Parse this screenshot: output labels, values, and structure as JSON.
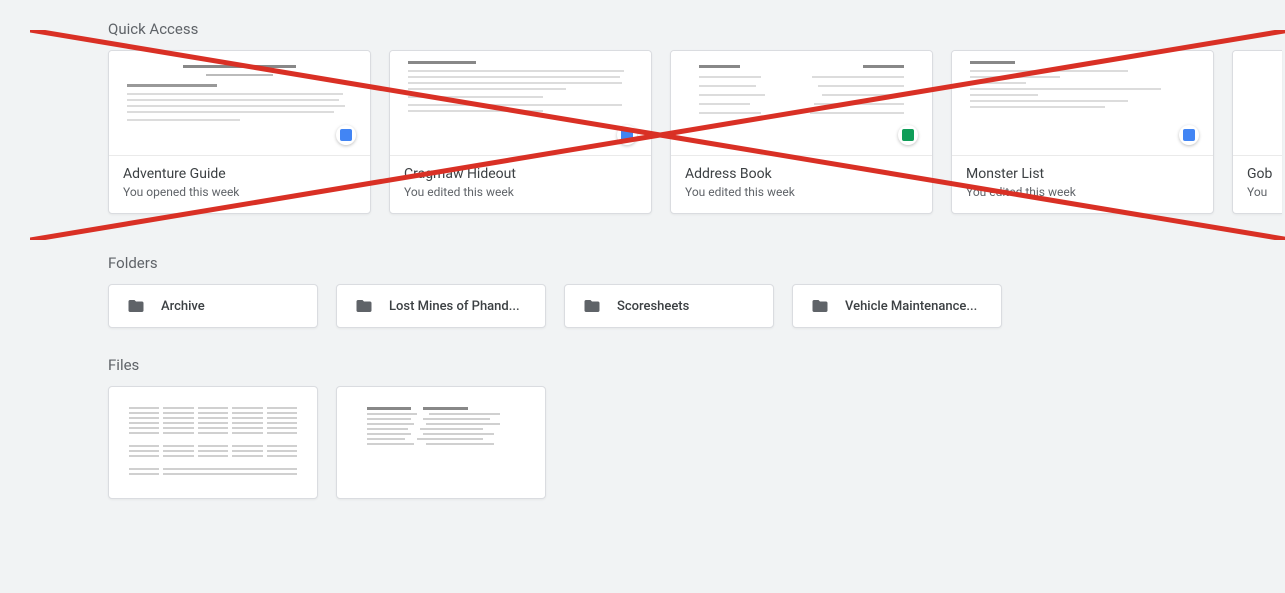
{
  "sections": {
    "quick_access_heading": "Quick Access",
    "folders_heading": "Folders",
    "files_heading": "Files"
  },
  "colors": {
    "docs_blue": "#4285f4",
    "sheets_green": "#0f9d58",
    "folder_grey": "#5f6368",
    "cross_red": "#d93025"
  },
  "quick_access": [
    {
      "title": "Adventure Guide",
      "subtitle": "You opened this week",
      "app": "docs"
    },
    {
      "title": "Cragmaw Hideout",
      "subtitle": "You edited this week",
      "app": "docs"
    },
    {
      "title": "Address Book",
      "subtitle": "You edited this week",
      "app": "sheets"
    },
    {
      "title": "Monster List",
      "subtitle": "You edited this week",
      "app": "docs"
    },
    {
      "title": "Gob",
      "subtitle": "You",
      "app": "docs"
    }
  ],
  "folders": [
    {
      "label": "Archive"
    },
    {
      "label": "Lost Mines of Phand..."
    },
    {
      "label": "Scoresheets"
    },
    {
      "label": "Vehicle Maintenance..."
    }
  ],
  "files_count": 2
}
